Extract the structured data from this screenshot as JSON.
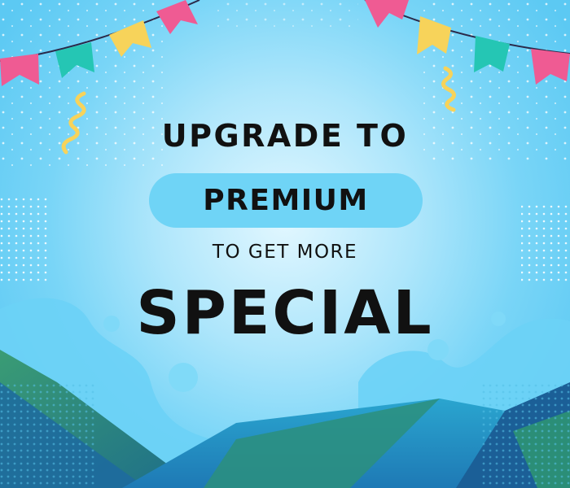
{
  "banner": {
    "line1": "UPGRADE TO",
    "highlight": "PREMIUM",
    "line3": "TO GET MORE",
    "line4": "SPECIAL"
  },
  "colors": {
    "background": "#5cc9f3",
    "glow": "#e2f7ff",
    "pill": "#6fd4f6",
    "text": "#111111",
    "flag_pink": "#ef5b93",
    "flag_teal": "#25c6b4",
    "flag_yellow": "#f7d35a",
    "mountain_green": "#2c8a6e",
    "mountain_blue": "#1f6fa5"
  },
  "decorations": [
    "bunting-flags-left",
    "bunting-flags-right",
    "confetti-streamer",
    "bubble-shapes",
    "dot-grid",
    "mountain-shapes"
  ]
}
